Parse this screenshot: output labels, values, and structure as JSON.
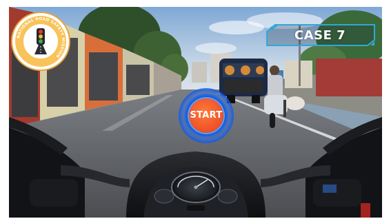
{
  "hud": {
    "case_label": "CASE 7",
    "start_label": "START"
  },
  "logo": {
    "ring_text": "NATIONAL ROAD SAFETY MISSION",
    "icon": "traffic-light-icon"
  },
  "colors": {
    "start_core": "#f0562a",
    "start_ring": "#1a4fc4",
    "case_panel_border": "#2fa8d8",
    "logo_ring": "#e8a33a",
    "logo_fill": "#f7c35a"
  },
  "scene_objects": {
    "icons": [
      "motorcycle-handlebar",
      "speedometer-icon",
      "mirror-icon",
      "auto-rickshaw",
      "scooter-rider",
      "street-shops",
      "road"
    ]
  }
}
